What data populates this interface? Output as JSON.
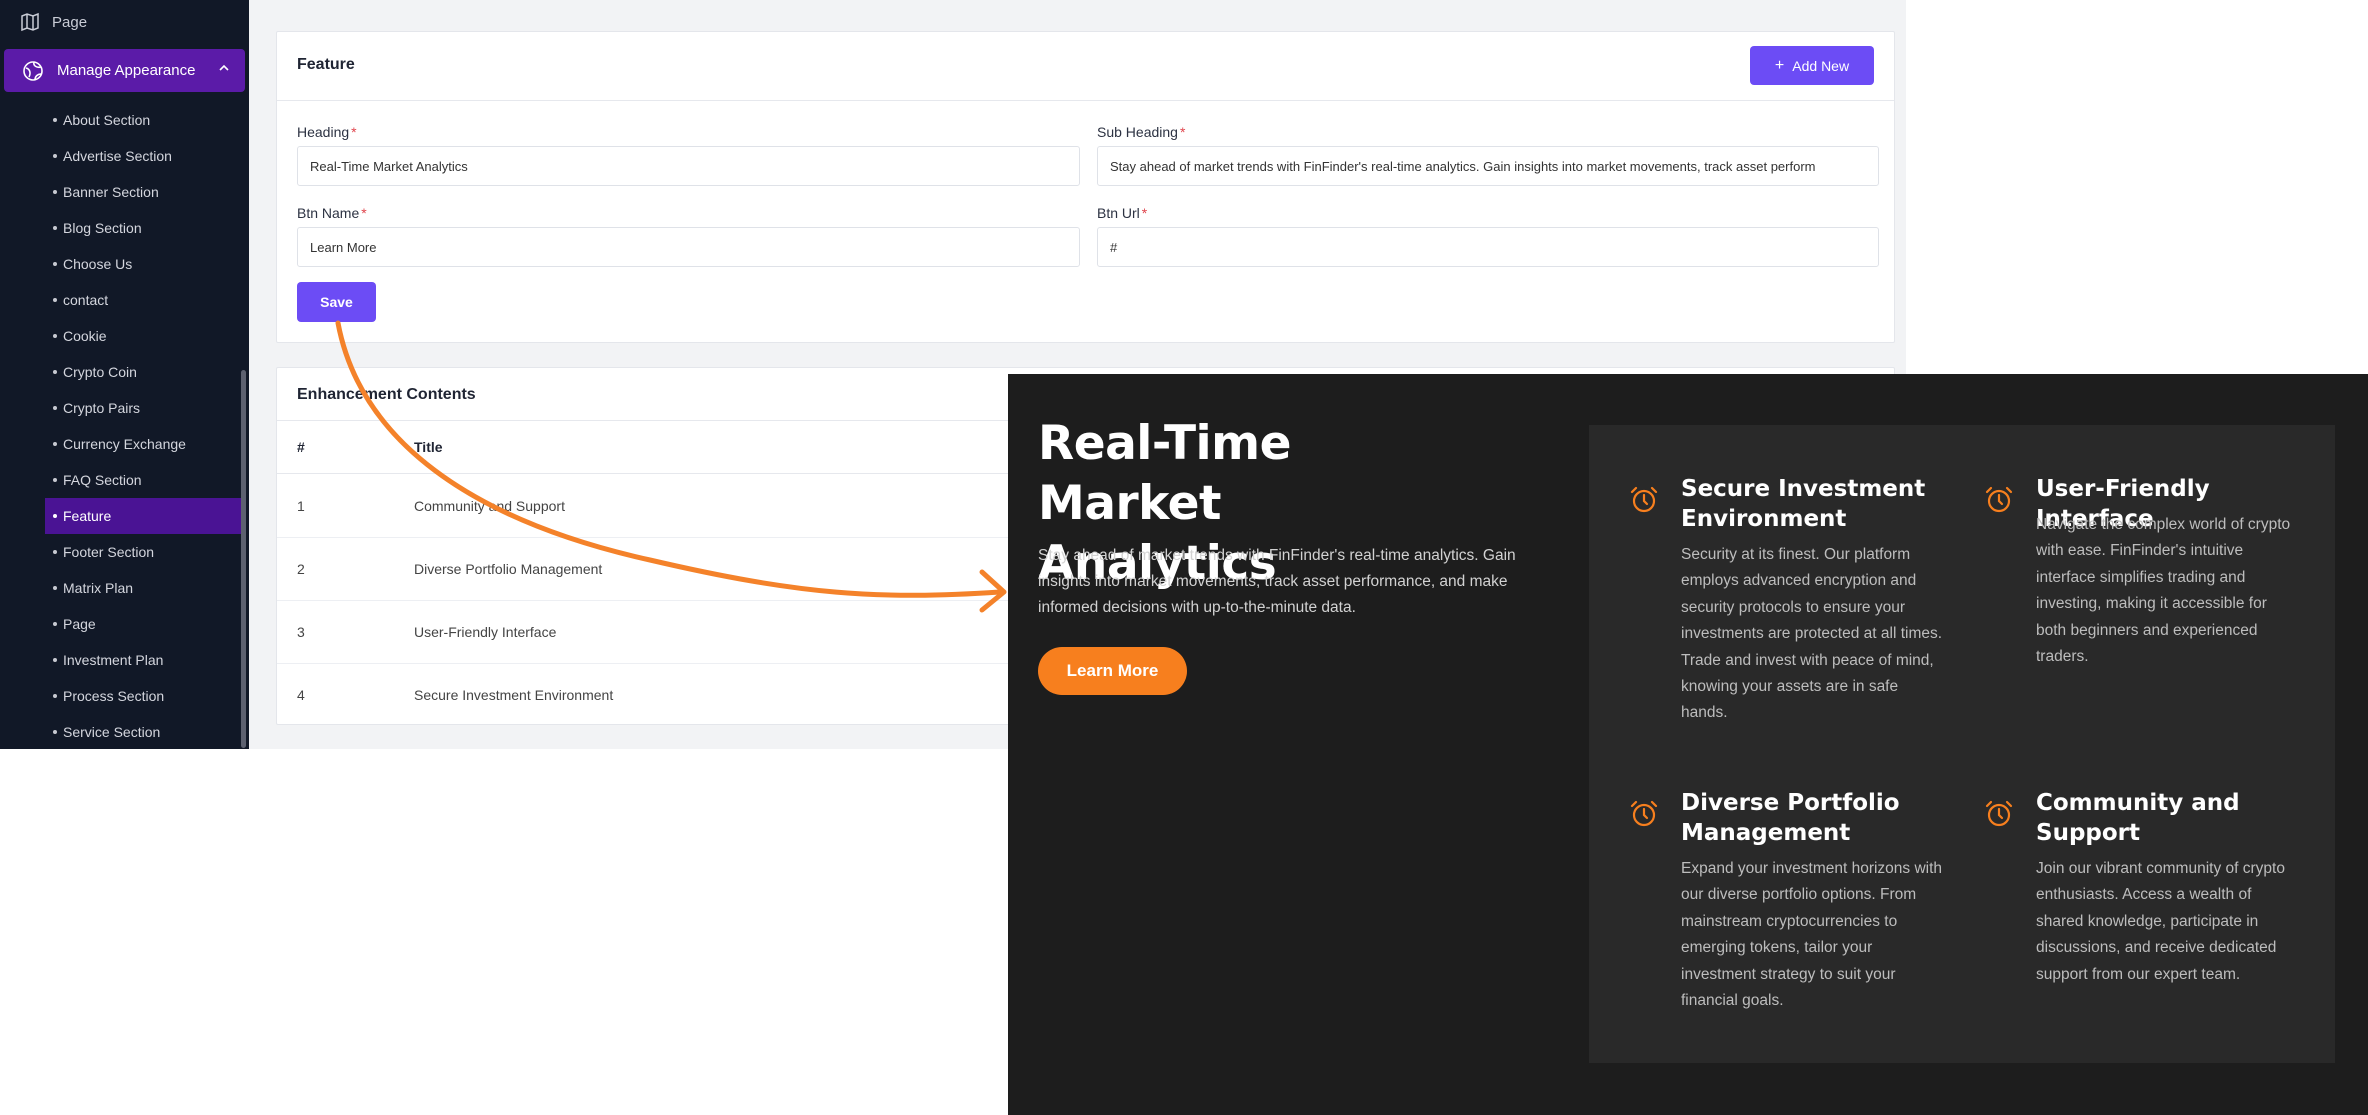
{
  "sidebar": {
    "top_item": "Page",
    "manage": "Manage Appearance",
    "items": [
      "About Section",
      "Advertise Section",
      "Banner Section",
      "Blog Section",
      "Choose Us",
      "contact",
      "Cookie",
      "Crypto Coin",
      "Crypto Pairs",
      "Currency Exchange",
      "FAQ Section",
      "Feature",
      "Footer Section",
      "Matrix Plan",
      "Page",
      "Investment Plan",
      "Process Section",
      "Service Section"
    ],
    "active_item": "Feature"
  },
  "feature_form": {
    "title": "Feature",
    "add_button": "Add New",
    "heading_label": "Heading",
    "heading_value": "Real-Time Market Analytics",
    "subheading_label": "Sub Heading",
    "subheading_value": "Stay ahead of market trends with FinFinder's real-time analytics. Gain insights into market movements, track asset perform",
    "btn_name_label": "Btn Name",
    "btn_name_value": "Learn More",
    "btn_url_label": "Btn Url",
    "btn_url_value": "#",
    "required_mark": "*",
    "save_button": "Save"
  },
  "contents_table": {
    "title": "Enhancement Contents",
    "columns": [
      "#",
      "Title"
    ],
    "rows": [
      {
        "num": "1",
        "title": "Community and Support"
      },
      {
        "num": "2",
        "title": "Diverse Portfolio Management"
      },
      {
        "num": "3",
        "title": "User-Friendly Interface"
      },
      {
        "num": "4",
        "title": "Secure Investment Environment"
      }
    ]
  },
  "preview": {
    "heading": "Real-Time Market Analytics",
    "subheading": "Stay ahead of market trends with FinFinder's real-time analytics. Gain insights into market movements, track asset performance, and make informed decisions with up-to-the-minute data.",
    "button": "Learn More",
    "features": [
      {
        "icon": "alarm-clock-icon",
        "title": "Secure Investment Environment",
        "text": "Security at its finest. Our platform employs advanced encryption and security protocols to ensure your investments are protected at all times. Trade and invest with peace of mind, knowing your assets are in safe hands."
      },
      {
        "icon": "alarm-clock-icon",
        "title": "User-Friendly Interface",
        "text": "Navigate the complex world of crypto with ease. FinFinder's intuitive interface simplifies trading and investing, making it accessible for both beginners and experienced traders."
      },
      {
        "icon": "alarm-clock-icon",
        "title": "Diverse Portfolio Management",
        "text": "Expand your investment horizons with our diverse portfolio options. From mainstream cryptocurrencies to emerging tokens, tailor your investment strategy to suit your financial goals."
      },
      {
        "icon": "alarm-clock-icon",
        "title": "Community and Support",
        "text": "Join our vibrant community of crypto enthusiasts. Access a wealth of shared knowledge, participate in discussions, and receive dedicated support from our expert team."
      }
    ]
  },
  "colors": {
    "sidebar_bg": "#111827",
    "active_purple": "#5b1ba8",
    "button_purple": "#6c4cf5",
    "accent_orange": "#f77f1e",
    "preview_bg": "#1d1d1d"
  }
}
